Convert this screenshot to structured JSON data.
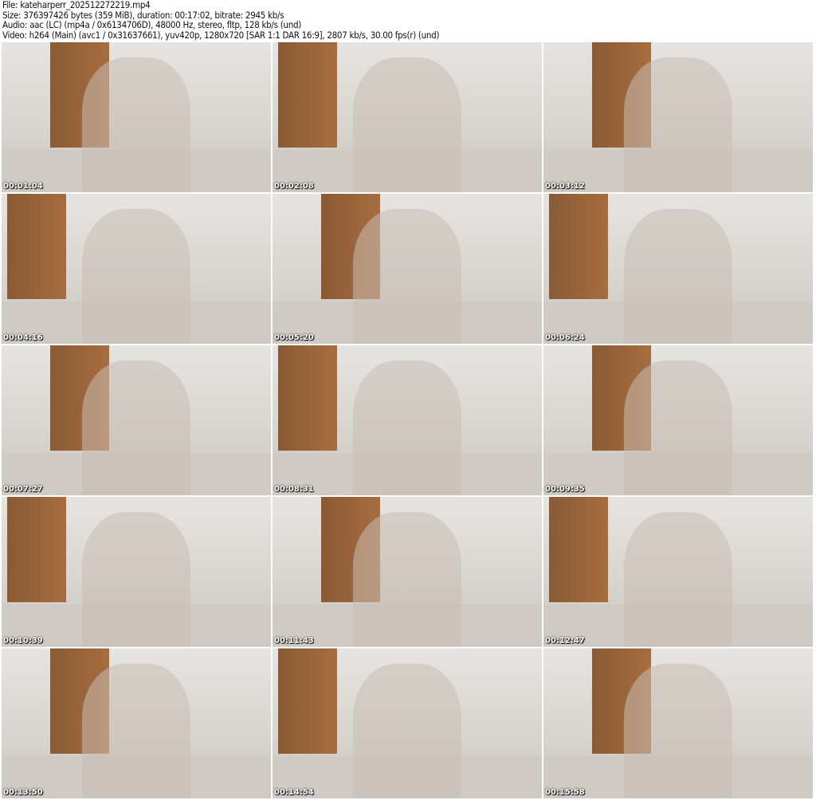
{
  "header": {
    "file": "File: kateharperr_202512272219.mp4",
    "size": "Size: 376397426 bytes (359 MiB), duration: 00:17:02, bitrate: 2945 kb/s",
    "audio": "Audio: aac (LC) (mp4a / 0x6134706D), 48000 Hz, stereo, fltp, 128 kb/s (und)",
    "video": "Video: h264 (Main) (avc1 / 0x31637661), yuv420p, 1280x720 [SAR 1:1 DAR 16:9], 2807 kb/s, 30.00 fps(r) (und)"
  },
  "thumbnails": [
    {
      "time": "00:01:04"
    },
    {
      "time": "00:02:08"
    },
    {
      "time": "00:03:12"
    },
    {
      "time": "00:04:16"
    },
    {
      "time": "00:05:20"
    },
    {
      "time": "00:06:24"
    },
    {
      "time": "00:07:27"
    },
    {
      "time": "00:08:31"
    },
    {
      "time": "00:09:35"
    },
    {
      "time": "00:10:39"
    },
    {
      "time": "00:11:43"
    },
    {
      "time": "00:12:47"
    },
    {
      "time": "00:13:50"
    },
    {
      "time": "00:14:54"
    },
    {
      "time": "00:15:58"
    }
  ]
}
